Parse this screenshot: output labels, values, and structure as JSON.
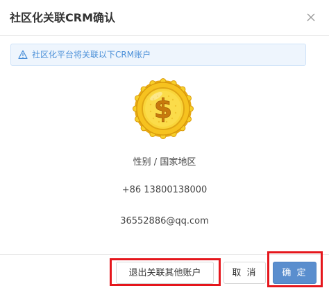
{
  "dialog": {
    "title": "社区化关联CRM确认",
    "close_icon": "close-icon"
  },
  "alert": {
    "icon": "warning-icon",
    "text": "社区化平台将关联以下CRM账户"
  },
  "account": {
    "avatar_icon": "dollar-coin-icon",
    "gender_region": "性别 / 国家地区",
    "phone": "+86 13800138000",
    "email": "36552886@qq.com"
  },
  "footer": {
    "unlink_label": "退出关联其他账户",
    "cancel_label": "取 消",
    "ok_label": "确 定"
  },
  "colors": {
    "accent": "#5a8ece",
    "alert_bg": "#eef5fd",
    "alert_text": "#4a8fd8",
    "highlight": "#e5161c",
    "coin_gold": "#f5c518"
  }
}
